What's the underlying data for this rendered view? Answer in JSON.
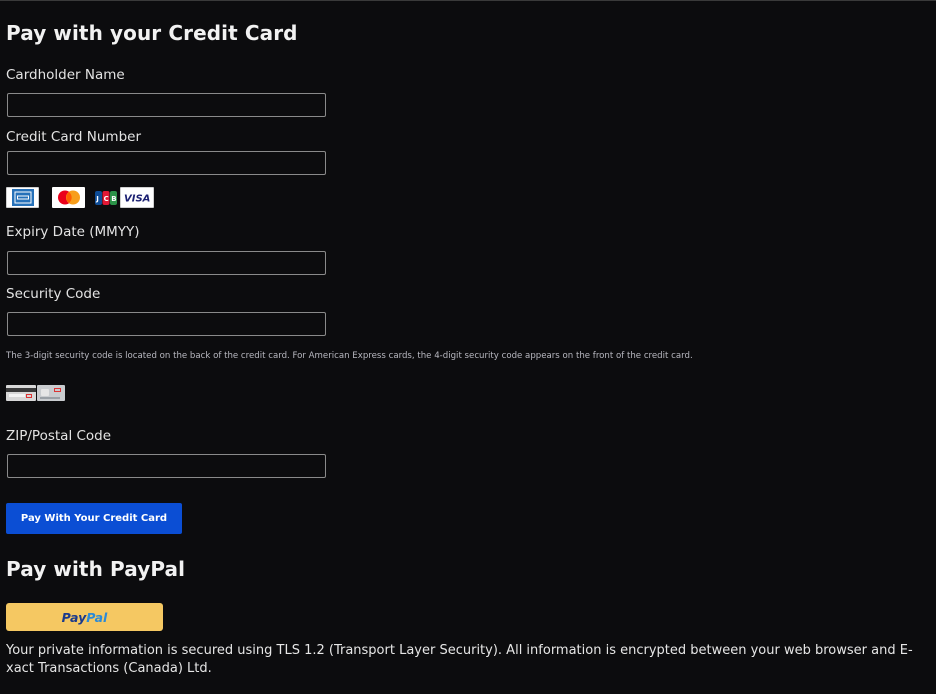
{
  "credit_card_section": {
    "title": "Pay with your Credit Card",
    "cardholder_name": {
      "label": "Cardholder Name",
      "value": "",
      "placeholder": ""
    },
    "card_number": {
      "label": "Credit Card Number",
      "value": "",
      "placeholder": ""
    },
    "accepted_cards": [
      {
        "name": "American Express",
        "icon": "amex-logo",
        "text": "AMEX",
        "color": "#2671b9"
      },
      {
        "name": "Mastercard",
        "icon": "mastercard-logo",
        "colors": [
          "#eb001b",
          "#f79e1b"
        ]
      },
      {
        "name": "JCB",
        "icon": "jcb-logo",
        "text": "JCB",
        "colors": [
          "#0e4c96",
          "#e21836",
          "#2b9348"
        ]
      },
      {
        "name": "Visa",
        "icon": "visa-logo",
        "text": "VISA",
        "color": "#1a1f71"
      }
    ],
    "expiry": {
      "label": "Expiry Date (MMYY)",
      "value": "",
      "placeholder": ""
    },
    "security_code": {
      "label": "Security Code",
      "value": "",
      "placeholder": "",
      "help": "The 3-digit security code is located on the back of the credit card. For American Express cards, the 4-digit security code appears on the front of the credit card."
    },
    "security_code_images": [
      "card-back-cvv-image",
      "amex-front-cid-image"
    ],
    "postal_code": {
      "label": "ZIP/Postal Code",
      "value": "",
      "placeholder": ""
    },
    "submit_label": "Pay With Your Credit Card",
    "submit_color": "#0b4ed4"
  },
  "paypal_section": {
    "title": "Pay with PayPal",
    "button_text_pay": "Pay",
    "button_text_pal": "Pal",
    "button_color": "#f5c862"
  },
  "security_note": "Your private information is secured using TLS 1.2 (Transport Layer Security). All information is encrypted between your web browser and E-xact Transactions (Canada) Ltd."
}
